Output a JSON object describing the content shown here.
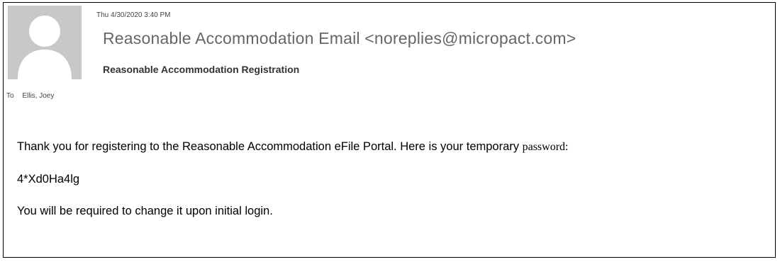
{
  "email": {
    "timestamp": "Thu 4/30/2020 3:40 PM",
    "sender": "Reasonable Accommodation Email <noreplies@micropact.com>",
    "subject": "Reasonable Accommodation Registration",
    "to_label": "To",
    "recipient": "Ellis, Joey",
    "avatar_icon": "default-person-icon"
  },
  "body": {
    "line1_text": "Thank you for registering to the Reasonable Accommodation eFile Portal. Here is your temporary ",
    "line1_word": "password",
    "line1_end": ":",
    "password_value": "4*Xd0Ha4lg",
    "line3_text": "You will be required to change it upon initial login."
  },
  "colors": {
    "avatar_background": "#c8c8c8",
    "avatar_figure": "#ffffff",
    "sender_text": "#666666",
    "border": "#000000"
  }
}
